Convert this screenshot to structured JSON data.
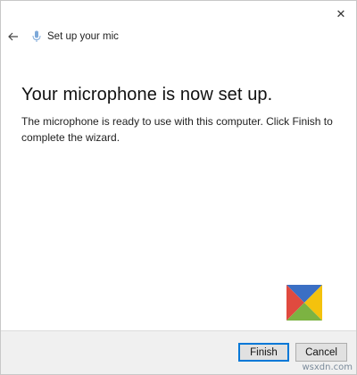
{
  "window": {
    "close_glyph": "✕"
  },
  "titlebar": {
    "back_icon": "back-arrow-icon",
    "mic_icon": "microphone-icon",
    "title": "Set up your mic"
  },
  "content": {
    "heading": "Your microphone is now set up.",
    "description": "The microphone is ready to use with this computer. Click Finish to complete the wizard."
  },
  "footer": {
    "finish_label": "Finish",
    "cancel_label": "Cancel"
  },
  "watermark": "wsxdn.com",
  "colors": {
    "accent": "#0078d7",
    "logo_blue": "#3b6fc4",
    "logo_red": "#e04a3f",
    "logo_green": "#7cb342",
    "logo_yellow": "#f4c20d"
  }
}
